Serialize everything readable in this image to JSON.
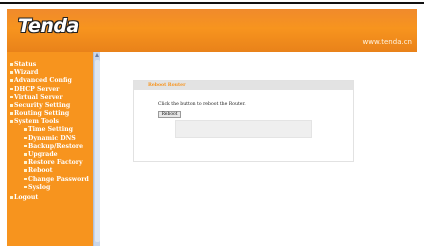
{
  "header": {
    "logo_text": "Tenda",
    "site_url": "www.tenda.cn"
  },
  "sidebar": {
    "items": [
      {
        "label": "Status",
        "level": 0
      },
      {
        "label": "Wizard",
        "level": 0
      },
      {
        "label": "Advanced Config",
        "level": 0
      },
      {
        "label": "DHCP Server",
        "level": 0
      },
      {
        "label": "Virtual Server",
        "level": 0
      },
      {
        "label": "Security Setting",
        "level": 0
      },
      {
        "label": "Routing Setting",
        "level": 0
      },
      {
        "label": "System Tools",
        "level": 0
      },
      {
        "label": "Time Setting",
        "level": 1
      },
      {
        "label": "Dynamic DNS",
        "level": 1
      },
      {
        "label": "Backup/Restore",
        "level": 1
      },
      {
        "label": "Upgrade",
        "level": 1
      },
      {
        "label": "Restore Factory",
        "level": 1
      },
      {
        "label": "Reboot",
        "level": 1
      },
      {
        "label": "Change Password",
        "level": 1
      },
      {
        "label": "Syslog",
        "level": 1
      },
      {
        "label": "Logout",
        "level": 0
      }
    ]
  },
  "main": {
    "panel_title": "Reboot Router",
    "description": "Click the button to reboot the Router.",
    "reboot_label": "Reboot"
  },
  "colors": {
    "brand_orange": "#f7941e",
    "panel_header": "#e3e3e3"
  }
}
